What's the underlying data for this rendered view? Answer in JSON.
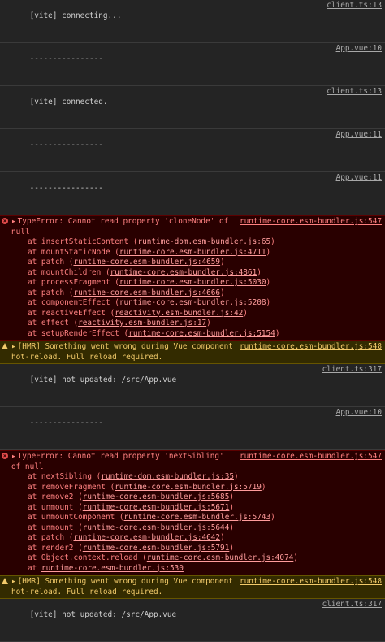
{
  "logs": [
    {
      "text": "[vite] connecting...",
      "source": "client.ts:13"
    },
    {
      "text": "----------------",
      "source": "App.vue:10"
    },
    {
      "text": "[vite] connected.",
      "source": "client.ts:13"
    },
    {
      "text": "----------------",
      "source": "App.vue:11"
    },
    {
      "text": "----------------",
      "source": "App.vue:11"
    }
  ],
  "error1": {
    "message": "TypeError: Cannot read property 'cloneNode' of null",
    "source": "runtime-core.esm-bundler.js:547",
    "frames": [
      {
        "fn": "at insertStaticContent (",
        "link": "runtime-dom.esm-bundler.js:65",
        "tail": ")"
      },
      {
        "fn": "at mountStaticNode (",
        "link": "runtime-core.esm-bundler.js:4711",
        "tail": ")"
      },
      {
        "fn": "at patch (",
        "link": "runtime-core.esm-bundler.js:4659",
        "tail": ")"
      },
      {
        "fn": "at mountChildren (",
        "link": "runtime-core.esm-bundler.js:4861",
        "tail": ")"
      },
      {
        "fn": "at processFragment (",
        "link": "runtime-core.esm-bundler.js:5030",
        "tail": ")"
      },
      {
        "fn": "at patch (",
        "link": "runtime-core.esm-bundler.js:4666",
        "tail": ")"
      },
      {
        "fn": "at componentEffect (",
        "link": "runtime-core.esm-bundler.js:5208",
        "tail": ")"
      },
      {
        "fn": "at reactiveEffect (",
        "link": "reactivity.esm-bundler.js:42",
        "tail": ")"
      },
      {
        "fn": "at effect (",
        "link": "reactivity.esm-bundler.js:17",
        "tail": ")"
      },
      {
        "fn": "at setupRenderEffect (",
        "link": "runtime-core.esm-bundler.js:5154",
        "tail": ")"
      }
    ]
  },
  "warn1": {
    "message": "[HMR] Something went wrong during Vue component hot-reload. Full reload required.",
    "source": "runtime-core.esm-bundler.js:548"
  },
  "log_updated1": {
    "text": "[vite] hot updated: /src/App.vue",
    "source": "client.ts:317"
  },
  "log_sep": {
    "text": "----------------",
    "source": "App.vue:10"
  },
  "error2": {
    "message": "TypeError: Cannot read property 'nextSibling' of null",
    "source": "runtime-core.esm-bundler.js:547",
    "frames": [
      {
        "fn": "at nextSibling (",
        "link": "runtime-dom.esm-bundler.js:35",
        "tail": ")"
      },
      {
        "fn": "at removeFragment (",
        "link": "runtime-core.esm-bundler.js:5719",
        "tail": ")"
      },
      {
        "fn": "at remove2 (",
        "link": "runtime-core.esm-bundler.js:5685",
        "tail": ")"
      },
      {
        "fn": "at unmount (",
        "link": "runtime-core.esm-bundler.js:5671",
        "tail": ")"
      },
      {
        "fn": "at unmountComponent (",
        "link": "runtime-core.esm-bundler.js:5743",
        "tail": ")"
      },
      {
        "fn": "at unmount (",
        "link": "runtime-core.esm-bundler.js:5644",
        "tail": ")"
      },
      {
        "fn": "at patch (",
        "link": "runtime-core.esm-bundler.js:4642",
        "tail": ")"
      },
      {
        "fn": "at render2 (",
        "link": "runtime-core.esm-bundler.js:5791",
        "tail": ")"
      },
      {
        "fn": "at Object.context.reload (",
        "link": "runtime-core.esm-bundler.js:4074",
        "tail": ")"
      },
      {
        "fn": "at ",
        "link": "runtime-core.esm-bundler.js:530",
        "tail": ""
      }
    ]
  },
  "warn2": {
    "message": "[HMR] Something went wrong during Vue component hot-reload. Full reload required.",
    "source": "runtime-core.esm-bundler.js:548"
  },
  "log_updated2": {
    "text": "[vite] hot updated: /src/App.vue",
    "source": "client.ts:317"
  }
}
